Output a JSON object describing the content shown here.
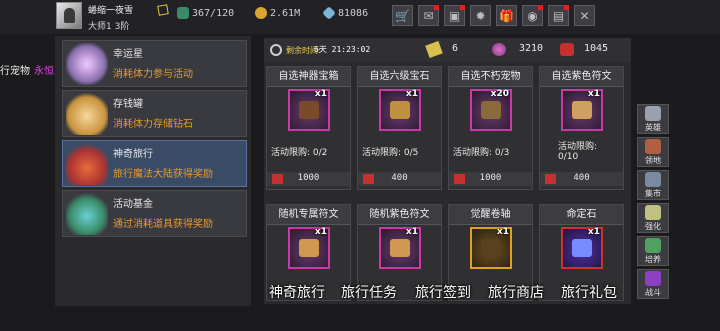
{
  "player": {
    "name": "蜷缩一夜雪",
    "rank": "大师1 3阶"
  },
  "resources": [
    {
      "icon": "stamina-icon",
      "value": "367/120"
    },
    {
      "icon": "gold-coin-icon",
      "value": "2.61M"
    },
    {
      "icon": "diamond-icon",
      "value": "81086"
    }
  ],
  "toolbar": [
    {
      "icon": "shop-cart-icon",
      "label": "🛒",
      "badge": false
    },
    {
      "icon": "mail-icon",
      "label": "✉",
      "badge": true
    },
    {
      "icon": "chest-icon",
      "label": "▣",
      "badge": true
    },
    {
      "icon": "settings-gear-icon",
      "label": "✹",
      "badge": false
    },
    {
      "icon": "gift-icon",
      "label": "🎁",
      "badge": false
    },
    {
      "icon": "wheel-icon",
      "label": "◉",
      "badge": true
    },
    {
      "icon": "book-icon",
      "label": "▤",
      "badge": true
    },
    {
      "icon": "close-x-icon",
      "label": "✕",
      "badge": false
    }
  ],
  "stray_text": {
    "white": "行宠物",
    "pink": "永恒之塔"
  },
  "activities": [
    {
      "title": "幸运星",
      "subtitle": "消耗体力参与活动",
      "selected": false,
      "icon": "lucky-star-icon"
    },
    {
      "title": "存钱罐",
      "subtitle": "消耗体力存储钻石",
      "selected": false,
      "icon": "piggy-bank-icon"
    },
    {
      "title": "神奇旅行",
      "subtitle": "旅行魔法大陆获得奖励",
      "selected": true,
      "icon": "travel-backpack-icon"
    },
    {
      "title": "活动基金",
      "subtitle": "通过消耗道具获得奖励",
      "selected": false,
      "icon": "fund-bag-icon"
    }
  ],
  "timer": {
    "label": "剩余时间:",
    "value": "6天 21:23:02"
  },
  "currencies": [
    {
      "icon": "ticket-icon",
      "value": "6"
    },
    {
      "icon": "gem-cluster-icon",
      "value": "3210"
    },
    {
      "icon": "ruby-icon",
      "value": "1045"
    }
  ],
  "row1": [
    {
      "title": "自选神器宝箱",
      "qty": "x1",
      "limit": "活动限购: 0/2",
      "price": "1000",
      "frame": "purple"
    },
    {
      "title": "自选六级宝石",
      "qty": "x1",
      "limit": "活动限购: 0/5",
      "price": "400",
      "frame": "purple"
    },
    {
      "title": "自选不朽宠物",
      "qty": "x20",
      "limit": "活动限购: 0/3",
      "price": "1000",
      "frame": "purple"
    },
    {
      "title": "自选紫色符文",
      "qty": "x1",
      "limit": "活动限购: 0/10",
      "price": "400",
      "frame": "purple"
    }
  ],
  "row2": [
    {
      "title": "随机专属符文",
      "qty": "x1",
      "frame": "purple"
    },
    {
      "title": "随机紫色符文",
      "qty": "x1",
      "frame": "purple"
    },
    {
      "title": "觉醒卷轴",
      "qty": "x1",
      "frame": "gold"
    },
    {
      "title": "命定石",
      "qty": "x1",
      "frame": "red"
    }
  ],
  "tabs": [
    "神奇旅行",
    "旅行任务",
    "旅行签到",
    "旅行商店",
    "旅行礼包"
  ],
  "sidebar": [
    {
      "label": "英雄",
      "icon": "hero-helmet-icon"
    },
    {
      "label": "领地",
      "icon": "territory-castle-icon"
    },
    {
      "label": "集市",
      "icon": "market-stall-icon"
    },
    {
      "label": "强化",
      "icon": "anvil-icon"
    },
    {
      "label": "培养",
      "icon": "potion-icon"
    },
    {
      "label": "战斗",
      "icon": "battle-portal-icon"
    }
  ]
}
